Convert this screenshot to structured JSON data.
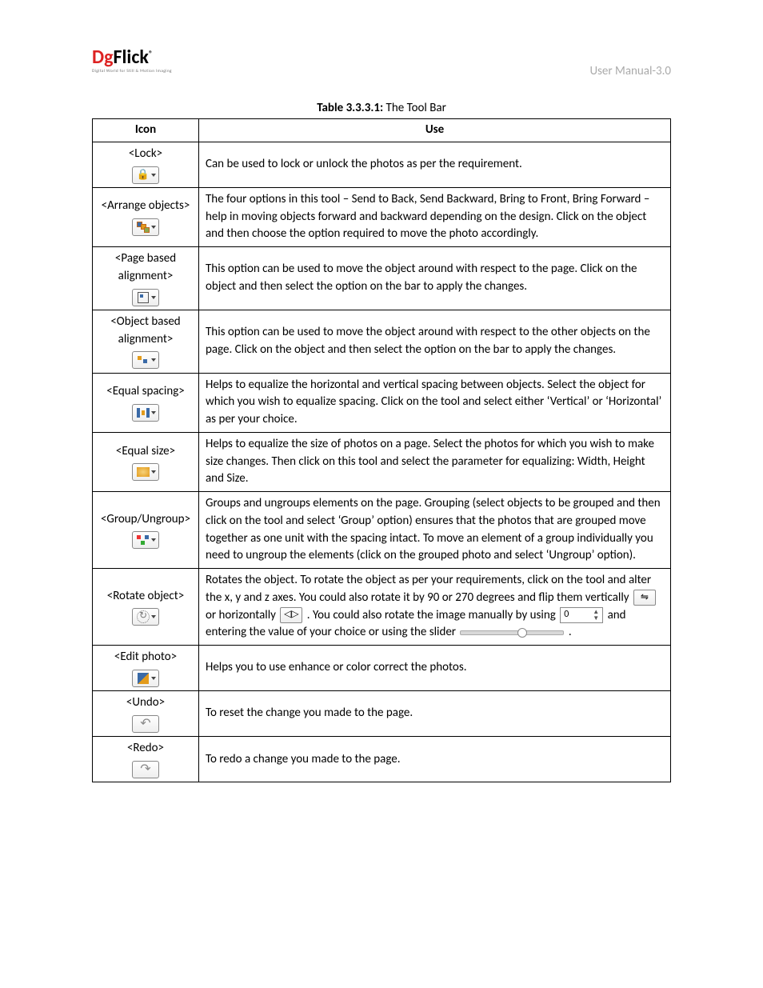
{
  "header": {
    "logo_main": "DgFlick",
    "logo_sub": "Digital World for Still & Motion Imaging",
    "doc_title": "User Manual-3.0"
  },
  "caption": {
    "bold": "Table 3.3.3.1:",
    "rest": "  The Tool Bar"
  },
  "columns": {
    "icon": "Icon",
    "use": "Use"
  },
  "rows": [
    {
      "label": "<Lock>",
      "use": "Can be used to lock or unlock the photos as per the requirement."
    },
    {
      "label": "<Arrange objects>",
      "use": "The four options in this tool – Send to Back, Send Backward, Bring to Front, Bring Forward – help in moving objects forward and backward depending on the design. Click on the object and then choose the option required to move the photo accordingly."
    },
    {
      "label": "<Page based alignment>",
      "use": "This option can be used to move the object around with respect to the page. Click on the object and then select the option on the bar to apply the changes."
    },
    {
      "label": "<Object based alignment>",
      "use": "This option can be used to move the object around with respect to the other objects on the page. Click on the object and then select the option on the bar to apply the changes."
    },
    {
      "label": "<Equal spacing>",
      "use": "Helps to equalize the horizontal and vertical spacing between objects. Select the object for which you wish to equalize spacing. Click on the tool and select either ‘Vertical’ or ‘Horizontal’ as per your choice."
    },
    {
      "label": "<Equal size>",
      "use": "Helps to equalize the size of photos on a page. Select the photos for which you wish to make size changes. Then click on this tool and select the parameter for equalizing: Width, Height and Size."
    },
    {
      "label": "<Group/Ungroup>",
      "use": "Groups and ungroups elements on the page. Grouping (select objects to be grouped and then click on the tool and select ‘Group’ option) ensures that the photos that are grouped move together as one unit with the spacing intact. To move an element of a group individually you need to ungroup the elements (click on the grouped photo and select ‘Ungroup’ option)."
    },
    {
      "label": "<Rotate object>",
      "use_pre": "Rotates the object. To rotate the object as per your requirements, click on the tool and alter the x, y and z axes. You could also rotate it by 90 or 270 degrees and flip them vertically ",
      "use_mid1": " or horizontally",
      "use_mid2": ". You could also rotate the image manually by using",
      "use_mid3": " and entering the value of your choice or using the slider",
      "use_end": ".",
      "spinner_value": "0"
    },
    {
      "label": "<Edit photo>",
      "use": "Helps you to use enhance or color correct the photos."
    },
    {
      "label": "<Undo>",
      "use": "To reset the change you made to the page."
    },
    {
      "label": "<Redo>",
      "use": "To redo a change you made to the page."
    }
  ]
}
